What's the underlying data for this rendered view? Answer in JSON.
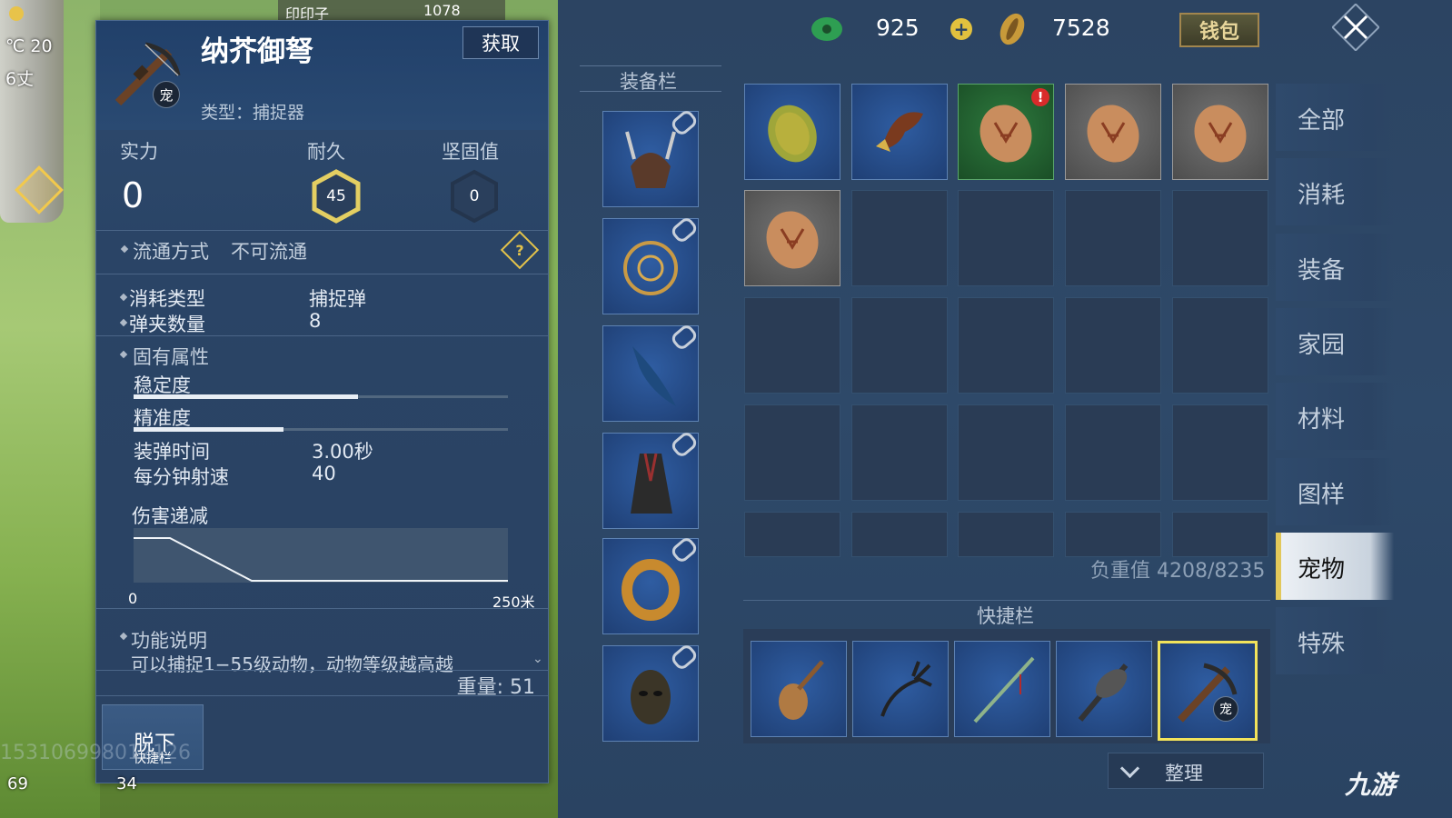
{
  "hud": {
    "temperature": "℃ 20",
    "altitude": "6丈",
    "top_name": "印印子",
    "top_value": "1078",
    "bottom_left": "69",
    "bottom_count": "34",
    "id_watermark": "153106998012126"
  },
  "detail": {
    "name": "纳芥御弩",
    "pet_badge": "宠",
    "get_button": "获取",
    "type_label": "类型：",
    "type_value": "捕捉器",
    "stats": {
      "power_label": "实力",
      "power_value": "0",
      "durability_label": "耐久",
      "durability_value": "45",
      "firmness_label": "坚固值",
      "firmness_value": "0"
    },
    "circulation_label": "流通方式",
    "circulation_value": "不可流通",
    "consume_type_label": "消耗类型",
    "consume_type_value": "捕捉弹",
    "clip_label": "弹夹数量",
    "clip_value": "8",
    "inherent_label": "固有属性",
    "stability_label": "稳定度",
    "stability_level": 0.6,
    "accuracy_label": "精准度",
    "accuracy_level": 0.4,
    "reload_label": "装弹时间",
    "reload_value": "3.00秒",
    "rpm_label": "每分钟射速",
    "rpm_value": "40",
    "damage_falloff_label": "伤害递减",
    "chart_min": "0",
    "chart_max": "250米",
    "function_label": "功能说明",
    "function_text": "可以捕捉1−55级动物，动物等级越高越",
    "weight": "重量: 51",
    "unequip": "脱下",
    "unequip_sub": "快捷栏"
  },
  "currency": {
    "jade": "925",
    "coin": "7528",
    "wallet": "钱包"
  },
  "equip_title": "装备栏",
  "equip_slots": [
    {
      "icon": "horned-helmet-icon"
    },
    {
      "icon": "necklace-icon"
    },
    {
      "icon": "cape-icon"
    },
    {
      "icon": "robe-icon"
    },
    {
      "icon": "ring-icon"
    },
    {
      "icon": "mask-icon"
    }
  ],
  "inventory": {
    "items": [
      {
        "icon": "dragon-egg-icon",
        "color": "blue"
      },
      {
        "icon": "eagle-head-icon",
        "color": "blue"
      },
      {
        "icon": "beast-egg-icon",
        "color": "green",
        "alert": "!"
      },
      {
        "icon": "beast-egg-icon",
        "color": "gray"
      },
      {
        "icon": "beast-egg-icon",
        "color": "gray"
      },
      {
        "icon": "beast-egg-icon",
        "color": "gray"
      }
    ],
    "weight_total": "负重值 4208/8235"
  },
  "quickbar": {
    "title": "快捷栏",
    "items": [
      {
        "icon": "pipa-icon"
      },
      {
        "icon": "whip-icon"
      },
      {
        "icon": "spear-icon"
      },
      {
        "icon": "axe-icon"
      },
      {
        "icon": "crossbow-icon",
        "badge": "宠",
        "selected": true
      }
    ],
    "tidy": "整理"
  },
  "tabs": [
    {
      "label": "全部"
    },
    {
      "label": "消耗"
    },
    {
      "label": "装备"
    },
    {
      "label": "家园"
    },
    {
      "label": "材料"
    },
    {
      "label": "图样"
    },
    {
      "label": "宠物",
      "active": true
    },
    {
      "label": "特殊"
    }
  ],
  "logo": "九游"
}
